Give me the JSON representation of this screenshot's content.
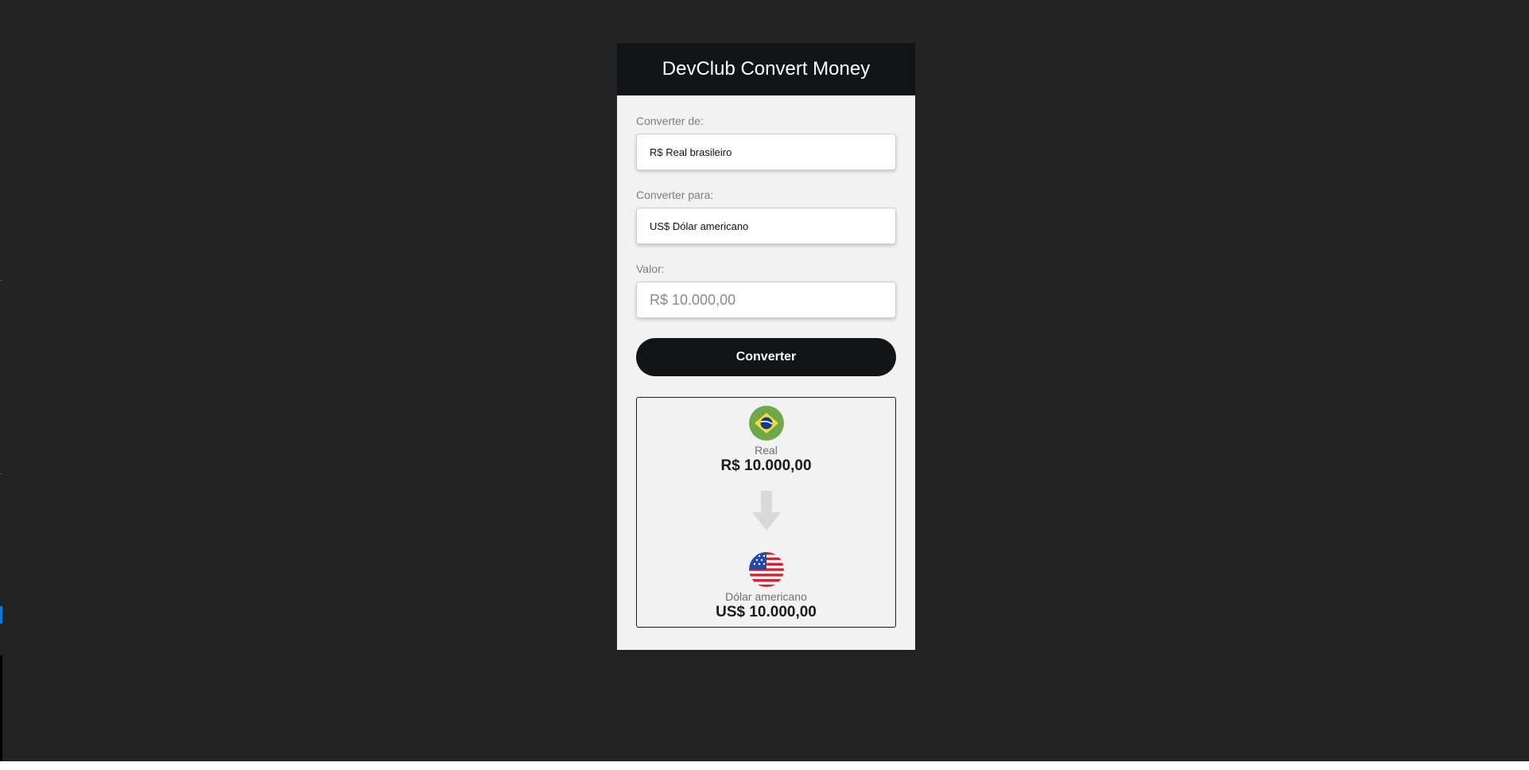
{
  "app": {
    "title": "DevClub Convert Money"
  },
  "form": {
    "from_label": "Converter de:",
    "from_selected": "R$ Real brasileiro",
    "to_label": "Converter para:",
    "to_selected": "US$ Dólar americano",
    "value_label": "Valor:",
    "value_placeholder": "R$ 10.000,00",
    "convert_button": "Converter"
  },
  "result": {
    "from": {
      "name": "Real",
      "value": "R$ 10.000,00",
      "flag": "brazil-flag-icon"
    },
    "arrow": "arrow-down-icon",
    "to": {
      "name": "Dólar americano",
      "value": "US$ 10.000,00",
      "flag": "usa-flag-icon"
    }
  },
  "colors": {
    "background": "#232323",
    "card": "#f2f2f2",
    "header": "#131416",
    "button": "#131416",
    "arrow": "#d9d9d9"
  }
}
